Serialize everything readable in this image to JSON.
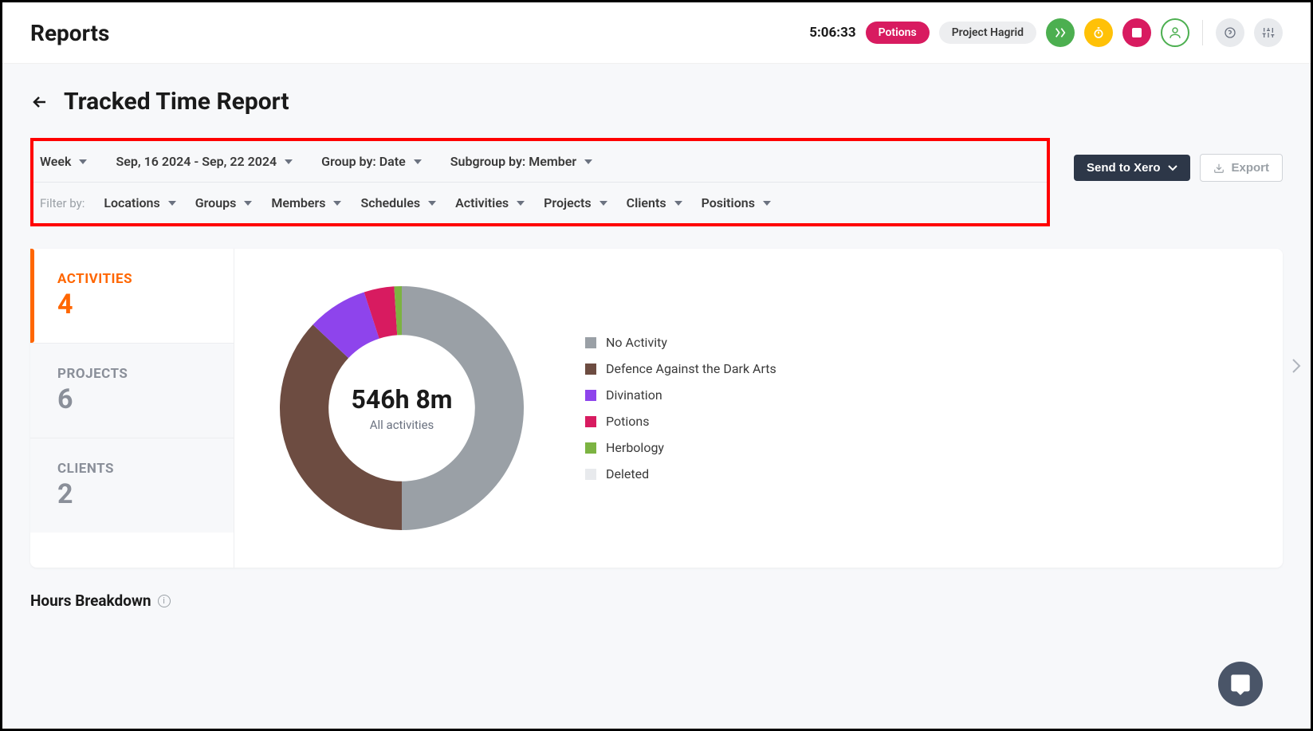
{
  "header": {
    "title": "Reports",
    "timer": "5:06:33",
    "tag1": "Potions",
    "tag2": "Project Hagrid"
  },
  "page": {
    "title": "Tracked Time Report"
  },
  "toolbar": {
    "period": "Week",
    "date_range": "Sep, 16 2024 - Sep, 22 2024",
    "group_by": "Group by: Date",
    "subgroup_by": "Subgroup by: Member",
    "filter_label": "Filter by:",
    "filters": {
      "locations": "Locations",
      "groups": "Groups",
      "members": "Members",
      "schedules": "Schedules",
      "activities": "Activities",
      "projects": "Projects",
      "clients": "Clients",
      "positions": "Positions"
    },
    "send_xero": "Send to Xero",
    "export": "Export"
  },
  "tabs": {
    "activities": {
      "label": "ACTIVITIES",
      "count": "4"
    },
    "projects": {
      "label": "PROJECTS",
      "count": "6"
    },
    "clients": {
      "label": "CLIENTS",
      "count": "2"
    }
  },
  "chart": {
    "total": "546h 8m",
    "subtitle": "All activities"
  },
  "legend": {
    "no_activity": "No Activity",
    "defence": "Defence Against the Dark Arts",
    "divination": "Divination",
    "potions": "Potions",
    "herbology": "Herbology",
    "deleted": "Deleted"
  },
  "colors": {
    "no_activity": "#9aa0a6",
    "defence": "#6d4c41",
    "divination": "#8e44ec",
    "potions": "#d81b60",
    "herbology": "#7cb342",
    "deleted": "#e8eaed"
  },
  "section": {
    "hours_breakdown": "Hours Breakdown"
  },
  "chart_data": {
    "type": "pie",
    "title": "All activities",
    "total_label": "546h 8m",
    "series": [
      {
        "name": "No Activity",
        "value": 50,
        "color": "#9aa0a6"
      },
      {
        "name": "Defence Against the Dark Arts",
        "value": 37,
        "color": "#6d4c41"
      },
      {
        "name": "Divination",
        "value": 8,
        "color": "#8e44ec"
      },
      {
        "name": "Potions",
        "value": 4,
        "color": "#d81b60"
      },
      {
        "name": "Herbology",
        "value": 1,
        "color": "#7cb342"
      },
      {
        "name": "Deleted",
        "value": 0,
        "color": "#e8eaed"
      }
    ]
  }
}
